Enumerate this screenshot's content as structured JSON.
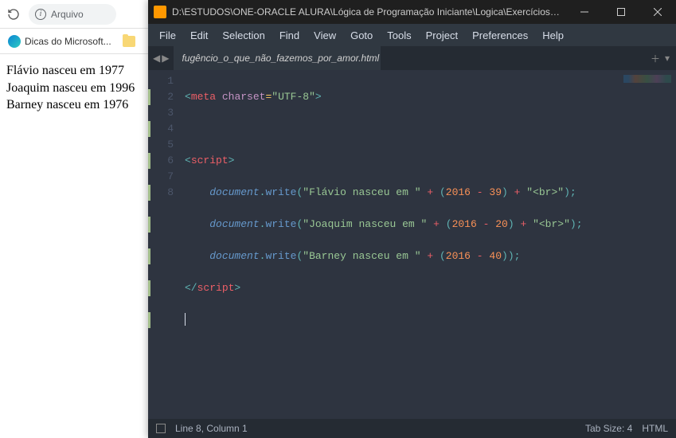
{
  "browser": {
    "address_text": "Arquivo",
    "bookmarks": [
      {
        "label": "Dicas do Microsoft..."
      }
    ],
    "content_lines": [
      "Flávio nasceu em 1977",
      "Joaquim nasceu em 1996",
      "Barney nasceu em 1976"
    ]
  },
  "sublime": {
    "title": "D:\\ESTUDOS\\ONE-ORACLE ALURA\\Lógica de Programação Iniciante\\Logica\\Exercícios\\fugê...",
    "menu": [
      "File",
      "Edit",
      "Selection",
      "Find",
      "View",
      "Goto",
      "Tools",
      "Project",
      "Preferences",
      "Help"
    ],
    "tab": {
      "label": "fugêncio_o_que_não_fazemos_por_amor.html"
    },
    "lines": [
      "1",
      "2",
      "3",
      "4",
      "5",
      "6",
      "7",
      "8"
    ],
    "code": {
      "l1": {
        "tag": "meta",
        "attr": "charset",
        "eq": "=",
        "val": "\"UTF-8\""
      },
      "l3": {
        "tag": "script"
      },
      "l4": {
        "obj": "document",
        "fn": "write",
        "str1": "\"Flávio nasceu em \"",
        "a": "2016",
        "b": "39",
        "str2": "\"<br>\""
      },
      "l5": {
        "obj": "document",
        "fn": "write",
        "str1": "\"Joaquim nasceu em \"",
        "a": "2016",
        "b": "20",
        "str2": "\"<br>\""
      },
      "l6": {
        "obj": "document",
        "fn": "write",
        "str1": "\"Barney nasceu em \"",
        "a": "2016",
        "b": "40"
      },
      "l7": {
        "tag": "script"
      }
    },
    "status": {
      "position": "Line 8, Column 1",
      "tab_size": "Tab Size: 4",
      "syntax": "HTML"
    }
  }
}
